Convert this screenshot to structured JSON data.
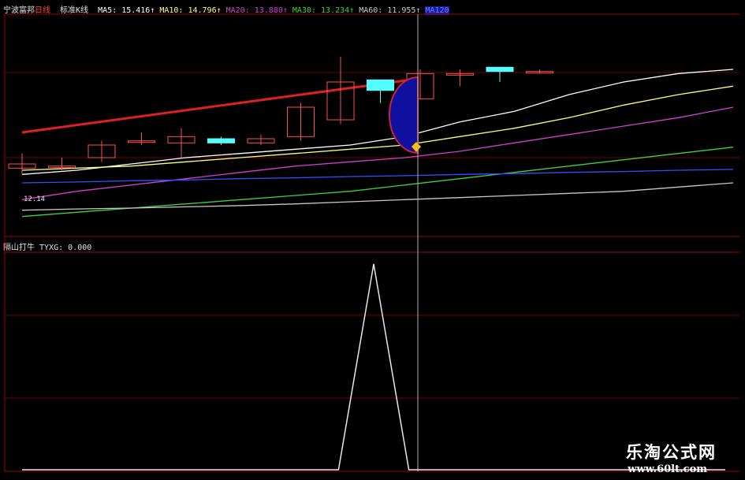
{
  "header": {
    "stock_name": "宁波富邦",
    "period": "日线",
    "chart_mode": "标准K线",
    "ma": [
      {
        "label": "MA5: 15.416↑",
        "color": "#ffffff"
      },
      {
        "label": "MA10: 14.796↑",
        "color": "#ffff80"
      },
      {
        "label": "MA20: 13.880↑",
        "color": "#d040d0"
      },
      {
        "label": "MA30: 13.234↑",
        "color": "#40d040"
      },
      {
        "label": "MA60: 11.955↑",
        "color": "#c8c8c8"
      },
      {
        "label": "MA120",
        "color": "#3050ff"
      }
    ]
  },
  "indicator": {
    "name": "隔山打牛",
    "value_label": "TYXG: 0.000"
  },
  "price_label": "12.14",
  "watermark": {
    "title": "乐淘公式网",
    "url": "www.60lt.com"
  },
  "chart_data": [
    {
      "type": "candlestick",
      "candles": [
        {
          "open": 12.25,
          "close": 12.35,
          "high": 12.6,
          "low": 12.1
        },
        {
          "open": 12.3,
          "close": 12.3,
          "high": 12.5,
          "low": 12.2
        },
        {
          "open": 12.5,
          "close": 12.8,
          "high": 12.9,
          "low": 12.4
        },
        {
          "open": 12.9,
          "close": 12.9,
          "high": 13.1,
          "low": 12.8
        },
        {
          "open": 12.85,
          "close": 13.0,
          "high": 13.2,
          "low": 12.5
        },
        {
          "open": 12.95,
          "close": 12.85,
          "high": 13.0,
          "low": 12.8
        },
        {
          "open": 12.85,
          "close": 12.95,
          "high": 13.05,
          "low": 12.8
        },
        {
          "open": 13.0,
          "close": 13.7,
          "high": 13.8,
          "low": 12.9
        },
        {
          "open": 13.4,
          "close": 14.3,
          "high": 14.9,
          "low": 13.3
        },
        {
          "open": 14.35,
          "close": 14.1,
          "high": 14.35,
          "low": 13.8
        },
        {
          "open": 13.9,
          "close": 14.5,
          "high": 14.6,
          "low": 13.9
        },
        {
          "open": 14.5,
          "close": 14.5,
          "high": 14.6,
          "low": 14.2
        },
        {
          "open": 14.65,
          "close": 14.55,
          "high": 14.65,
          "low": 14.3
        },
        {
          "open": 14.55,
          "close": 14.55,
          "high": 14.6,
          "low": 14.5
        }
      ],
      "ma_series": [
        {
          "name": "MA5",
          "color": "#ffffff",
          "points": [
            12.1,
            12.2,
            12.35,
            12.5,
            12.6,
            12.7,
            12.8,
            13.0,
            13.35,
            13.6,
            14.0,
            14.3,
            14.5,
            14.6
          ]
        },
        {
          "name": "MA10",
          "color": "#ffff80",
          "points": [
            12.2,
            12.25,
            12.3,
            12.4,
            12.5,
            12.6,
            12.7,
            12.8,
            13.0,
            13.2,
            13.45,
            13.75,
            14.0,
            14.2
          ]
        },
        {
          "name": "MA20",
          "color": "#d040d0",
          "points": [
            11.5,
            11.7,
            11.85,
            12.0,
            12.15,
            12.3,
            12.4,
            12.5,
            12.65,
            12.85,
            13.05,
            13.25,
            13.45,
            13.7
          ]
        },
        {
          "name": "MA30",
          "color": "#40d040",
          "points": [
            11.1,
            11.2,
            11.3,
            11.4,
            11.5,
            11.6,
            11.7,
            11.85,
            12.0,
            12.15,
            12.3,
            12.45,
            12.6,
            12.75
          ]
        },
        {
          "name": "MA60",
          "color": "#c8c8c8",
          "points": [
            11.25,
            11.28,
            11.3,
            11.33,
            11.36,
            11.4,
            11.45,
            11.5,
            11.55,
            11.6,
            11.65,
            11.7,
            11.8,
            11.9
          ]
        },
        {
          "name": "MA120",
          "color": "#3050ff",
          "points": [
            11.9,
            11.92,
            11.95,
            11.97,
            12.0,
            12.02,
            12.05,
            12.07,
            12.1,
            12.12,
            12.15,
            12.17,
            12.2,
            12.22
          ]
        }
      ],
      "ylim": [
        11.0,
        15.5
      ]
    },
    {
      "type": "line",
      "name": "TYXG",
      "points": [
        0,
        0,
        0,
        0,
        0,
        0,
        0,
        0,
        0,
        0,
        1,
        0,
        0,
        0,
        0,
        0,
        0,
        0,
        0,
        0,
        0
      ],
      "ylim": [
        0,
        1
      ]
    }
  ]
}
